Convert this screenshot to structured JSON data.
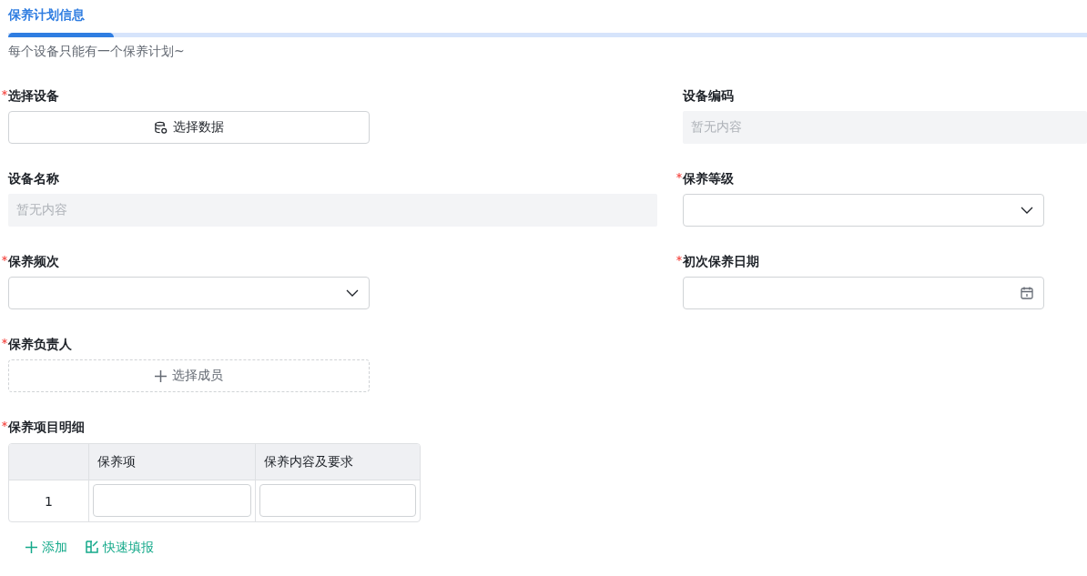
{
  "tab": {
    "label": "保养计划信息",
    "selected": true
  },
  "hint": "每个设备只能有一个保养计划~",
  "fields": [
    {
      "label": "选择设备",
      "required": true,
      "kind": "picker",
      "text": "选择数据"
    },
    {
      "label": "设备编码",
      "required": false,
      "kind": "readonly",
      "placeholder": "暂无内容"
    },
    {
      "label": "设备名称",
      "required": false,
      "kind": "readonly",
      "placeholder": "暂无内容"
    },
    {
      "label": "保养等级",
      "required": true,
      "kind": "select"
    },
    {
      "label": "保养频次",
      "required": true,
      "kind": "select"
    },
    {
      "label": "初次保养日期",
      "required": true,
      "kind": "date"
    },
    {
      "label": "保养负责人",
      "required": true,
      "kind": "member",
      "text": "选择成员"
    }
  ],
  "items_table": {
    "label": "保养项目明细",
    "required": true,
    "columns": [
      "保养项",
      "保养内容及要求"
    ],
    "rows": [
      {
        "index": "1"
      }
    ]
  },
  "actions": [
    {
      "kind": "add",
      "label": "添加"
    },
    {
      "kind": "quick",
      "label": "快速填报"
    }
  ]
}
